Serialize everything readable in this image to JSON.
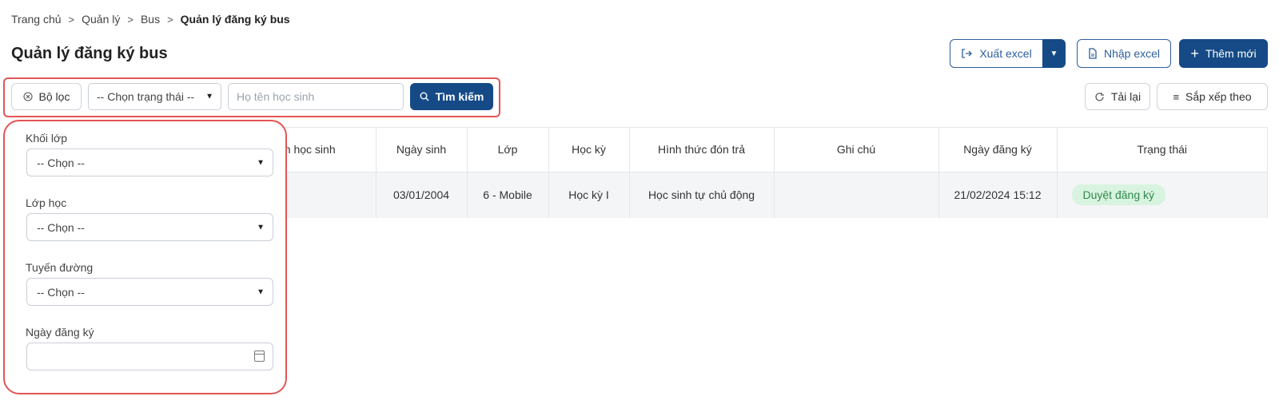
{
  "breadcrumb": {
    "items": [
      "Trang chủ",
      "Quản lý",
      "Bus"
    ],
    "current": "Quản lý đăng ký bus",
    "separator": ">"
  },
  "page": {
    "title": "Quản lý đăng ký bus"
  },
  "actions": {
    "export": "Xuất excel",
    "import": "Nhập excel",
    "add": "Thêm mới",
    "reload": "Tải lại",
    "sort": "Sắp xếp theo"
  },
  "toolbar": {
    "filter_button": "Bộ lọc",
    "status_select": "-- Chọn trạng thái --",
    "search_placeholder": "Họ tên học sinh",
    "search_button": "Tìm kiếm"
  },
  "table": {
    "headers": [
      "ên học sinh",
      "Ngày sinh",
      "Lớp",
      "Học kỳ",
      "Hình thức đón trả",
      "Ghi chú",
      "Ngày đăng ký",
      "Trạng thái"
    ],
    "rows": [
      {
        "dob": "03/01/2004",
        "class": "6 - Mobile",
        "semester": "Học kỳ I",
        "pickup": "Học sinh tự chủ động",
        "note": "",
        "registered": "21/02/2024 15:12",
        "status": "Duyệt đăng ký"
      }
    ]
  },
  "filter_panel": {
    "grade_label": "Khối lớp",
    "grade_value": "-- Chọn --",
    "class_label": "Lớp học",
    "class_value": "-- Chọn --",
    "route_label": "Tuyến đường",
    "route_value": "-- Chọn --",
    "date_label": "Ngày đăng ký",
    "date_value": ""
  },
  "colors": {
    "primary": "#154a86",
    "highlight": "#e25555",
    "badge_bg": "#d8f3df",
    "badge_text": "#2f8a4c"
  }
}
